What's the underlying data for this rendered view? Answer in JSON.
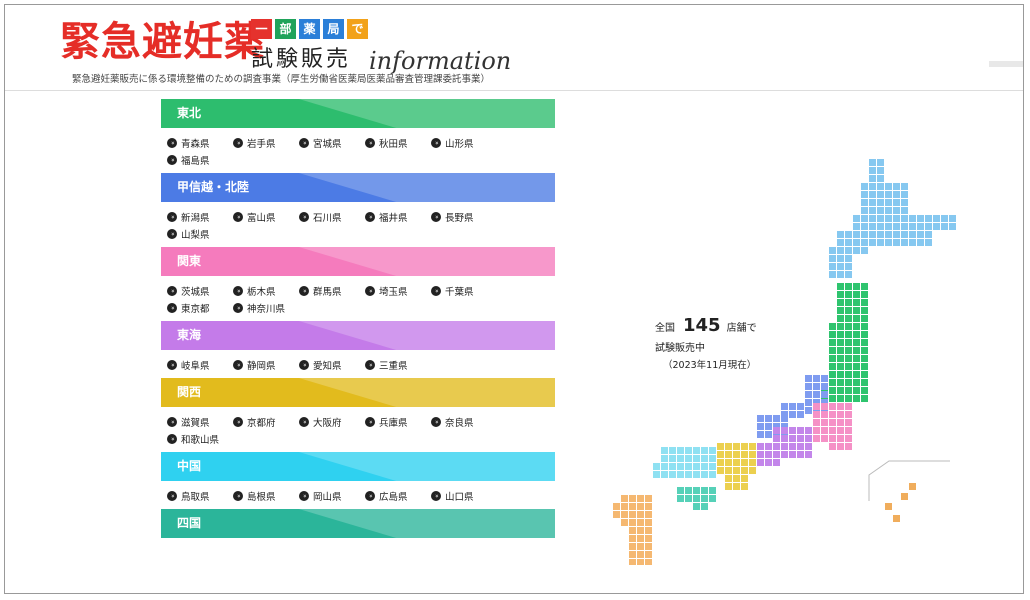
{
  "header": {
    "logo_main": "緊急避妊薬",
    "chips": [
      {
        "text": "一",
        "color": "#e5322d"
      },
      {
        "text": "部",
        "color": "#20a35a"
      },
      {
        "text": "薬",
        "color": "#2b7fd8"
      },
      {
        "text": "局",
        "color": "#2b7fd8"
      },
      {
        "text": "で",
        "color": "#f2a21a"
      }
    ],
    "trial": "試験販売",
    "info": "information",
    "subtitle": "緊急避妊薬販売に係る環境整備のための調査事業（厚生労働省医薬局医薬品審査管理課委託事業）"
  },
  "regions": [
    {
      "name": "東北",
      "color": "#2dbd6e",
      "prefs": [
        "青森県",
        "岩手県",
        "宮城県",
        "秋田県",
        "山形県",
        "福島県"
      ]
    },
    {
      "name": "甲信越・北陸",
      "color": "#4c7be5",
      "prefs": [
        "新潟県",
        "富山県",
        "石川県",
        "福井県",
        "長野県",
        "山梨県"
      ]
    },
    {
      "name": "関東",
      "color": "#f57bbd",
      "prefs": [
        "茨城県",
        "栃木県",
        "群馬県",
        "埼玉県",
        "千葉県",
        "東京都",
        "神奈川県"
      ]
    },
    {
      "name": "東海",
      "color": "#c47be9",
      "prefs": [
        "岐阜県",
        "静岡県",
        "愛知県",
        "三重県"
      ]
    },
    {
      "name": "関西",
      "color": "#e2bb1d",
      "prefs": [
        "滋賀県",
        "京都府",
        "大阪府",
        "兵庫県",
        "奈良県",
        "和歌山県"
      ]
    },
    {
      "name": "中国",
      "color": "#2fd1f0",
      "prefs": [
        "鳥取県",
        "島根県",
        "岡山県",
        "広島県",
        "山口県"
      ]
    },
    {
      "name": "四国",
      "color": "#2bb59a",
      "prefs": []
    }
  ],
  "stats": {
    "prefix": "全国",
    "count": "145",
    "unit": "店舗で",
    "line2": "試験販売中",
    "line3": "（2023年11月現在）"
  },
  "map": {
    "colors": {
      "hokkaido": "#86c8f0",
      "tohoku": "#2ec46e",
      "kanto": "#f591c6",
      "koshinetsu": "#7f9cf0",
      "tokai": "#c386ea",
      "kansai": "#ecd04f",
      "chugoku": "#8fe1f2",
      "shikoku": "#56d1b8",
      "kyushu": "#f5b871",
      "okinawa": "#f0ad5c"
    }
  }
}
